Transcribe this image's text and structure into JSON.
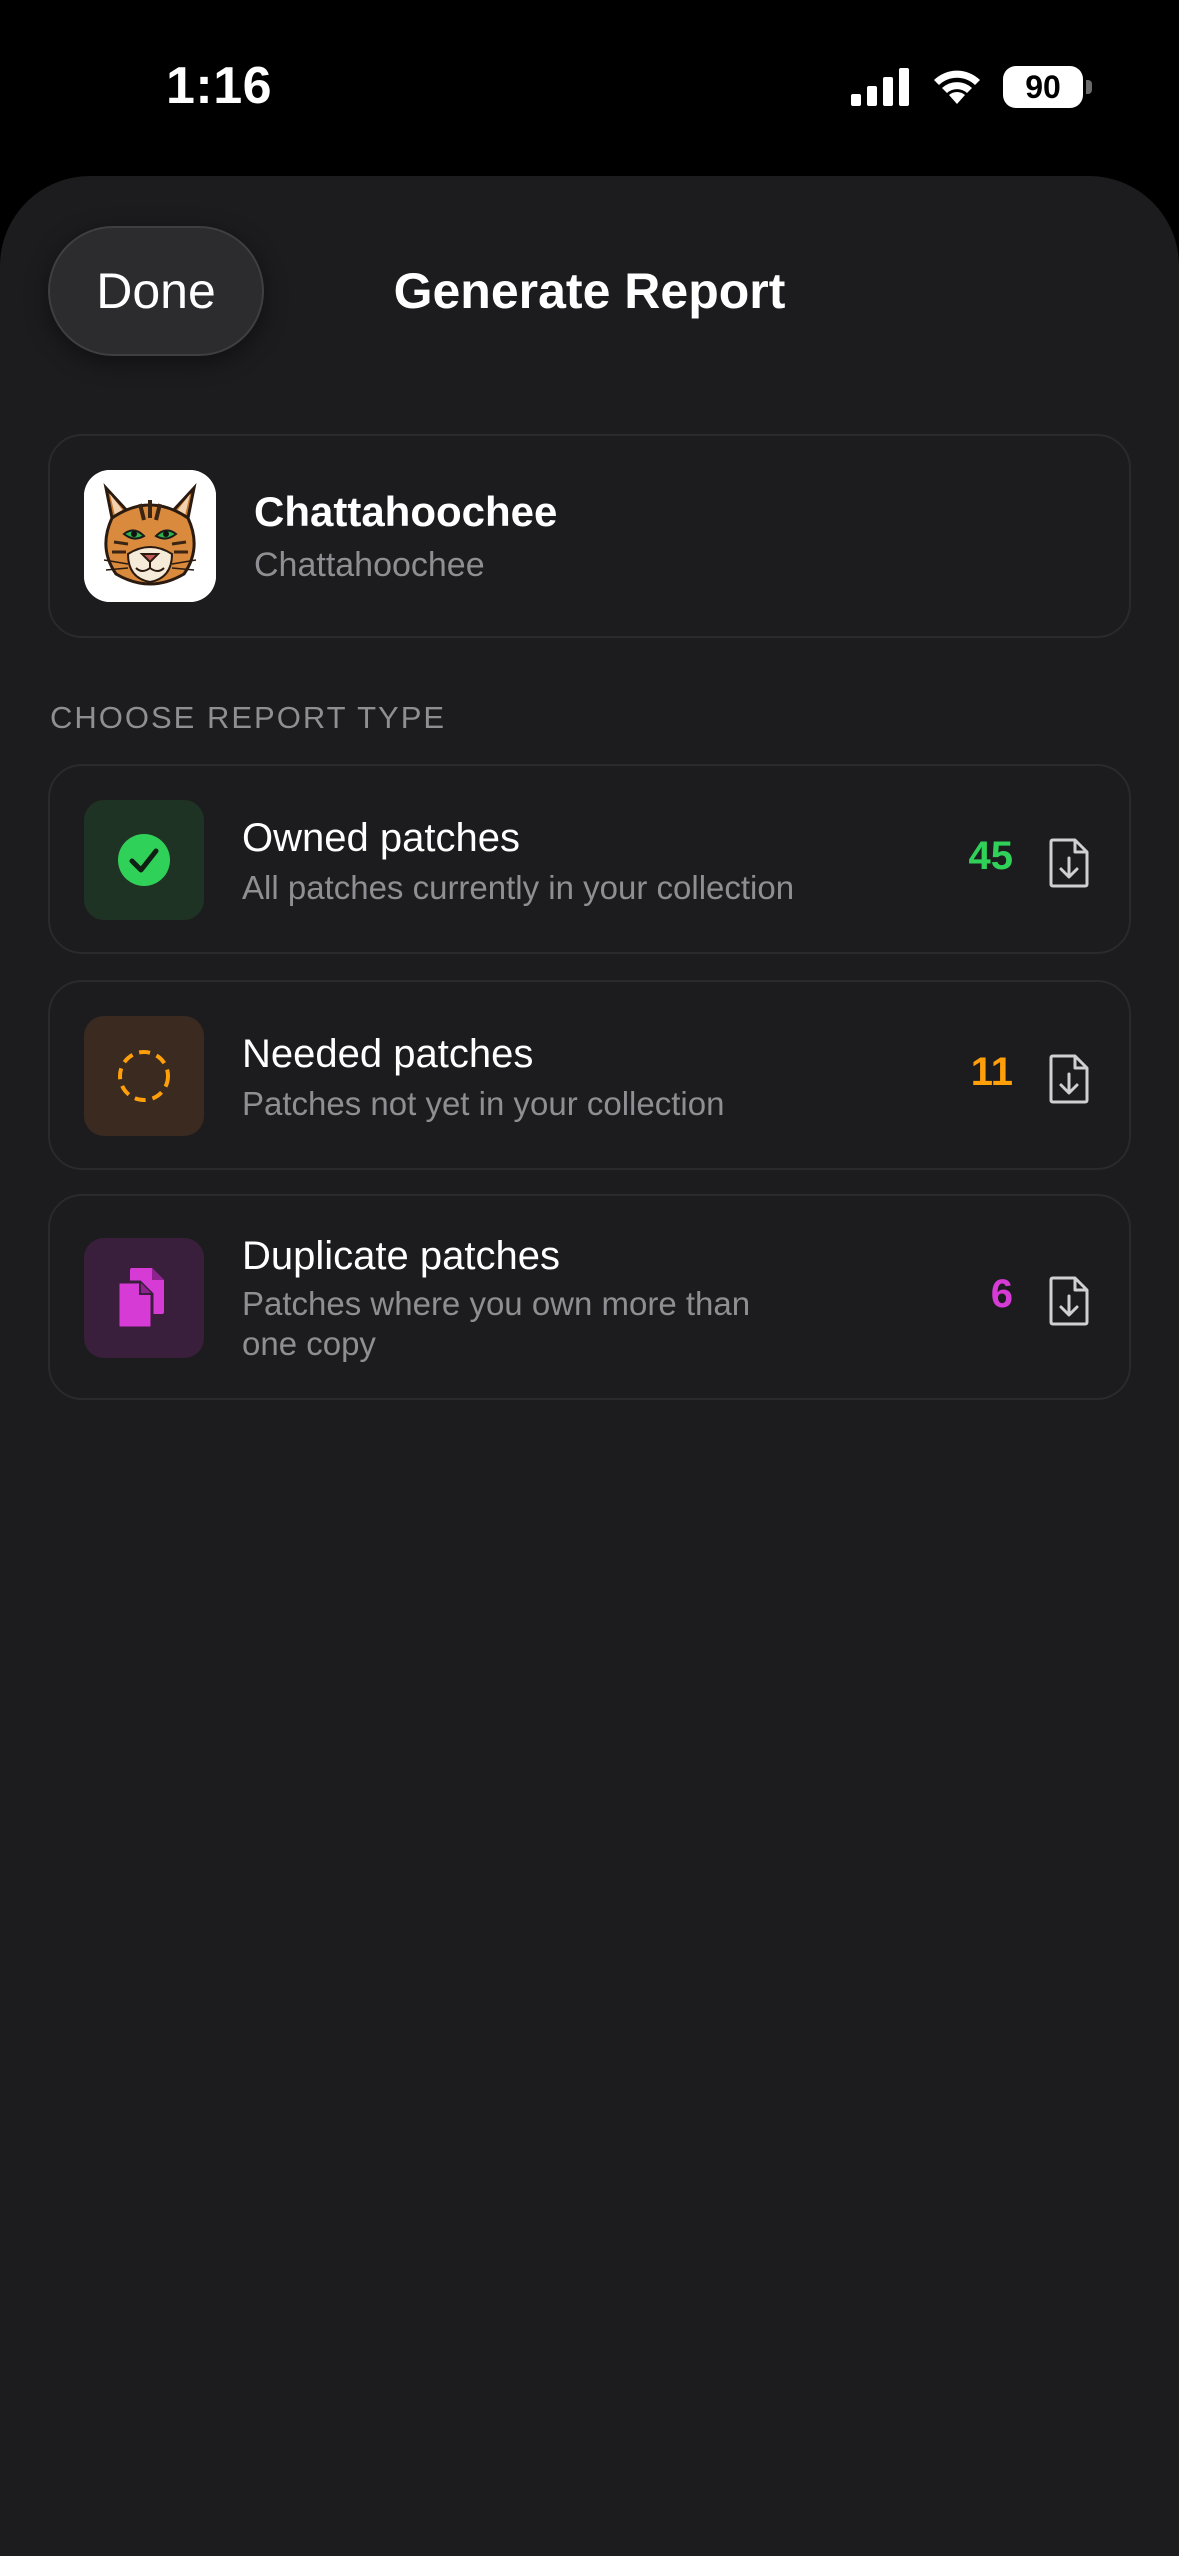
{
  "status": {
    "time": "1:16",
    "battery": "90",
    "icons": [
      "cellular-signal-icon",
      "wifi-icon",
      "battery-icon"
    ]
  },
  "sheet": {
    "done_label": "Done",
    "title": "Generate Report"
  },
  "profile": {
    "name": "Chattahoochee",
    "subtitle": "Chattahoochee",
    "avatar": "bobcat-logo"
  },
  "section": {
    "label": "CHOOSE REPORT TYPE"
  },
  "reports": [
    {
      "title": "Owned patches",
      "description": "All patches currently in your collection",
      "count": "45",
      "icon": "checkmark-circle-icon",
      "accent": "#30d158",
      "tile": "#1f3325"
    },
    {
      "title": "Needed patches",
      "description": "Patches not yet in your collection",
      "count": "11",
      "icon": "dashed-circle-icon",
      "accent": "#ff9f0a",
      "tile": "#3a2a1f"
    },
    {
      "title": "Duplicate patches",
      "description": "Patches where you own more than one copy",
      "count": "6",
      "icon": "duplicate-docs-icon",
      "accent": "#d63bd6",
      "tile": "#3a1f3d"
    }
  ],
  "colors": {
    "background": "#1c1c1e",
    "secondary_text": "#8e8e93"
  }
}
